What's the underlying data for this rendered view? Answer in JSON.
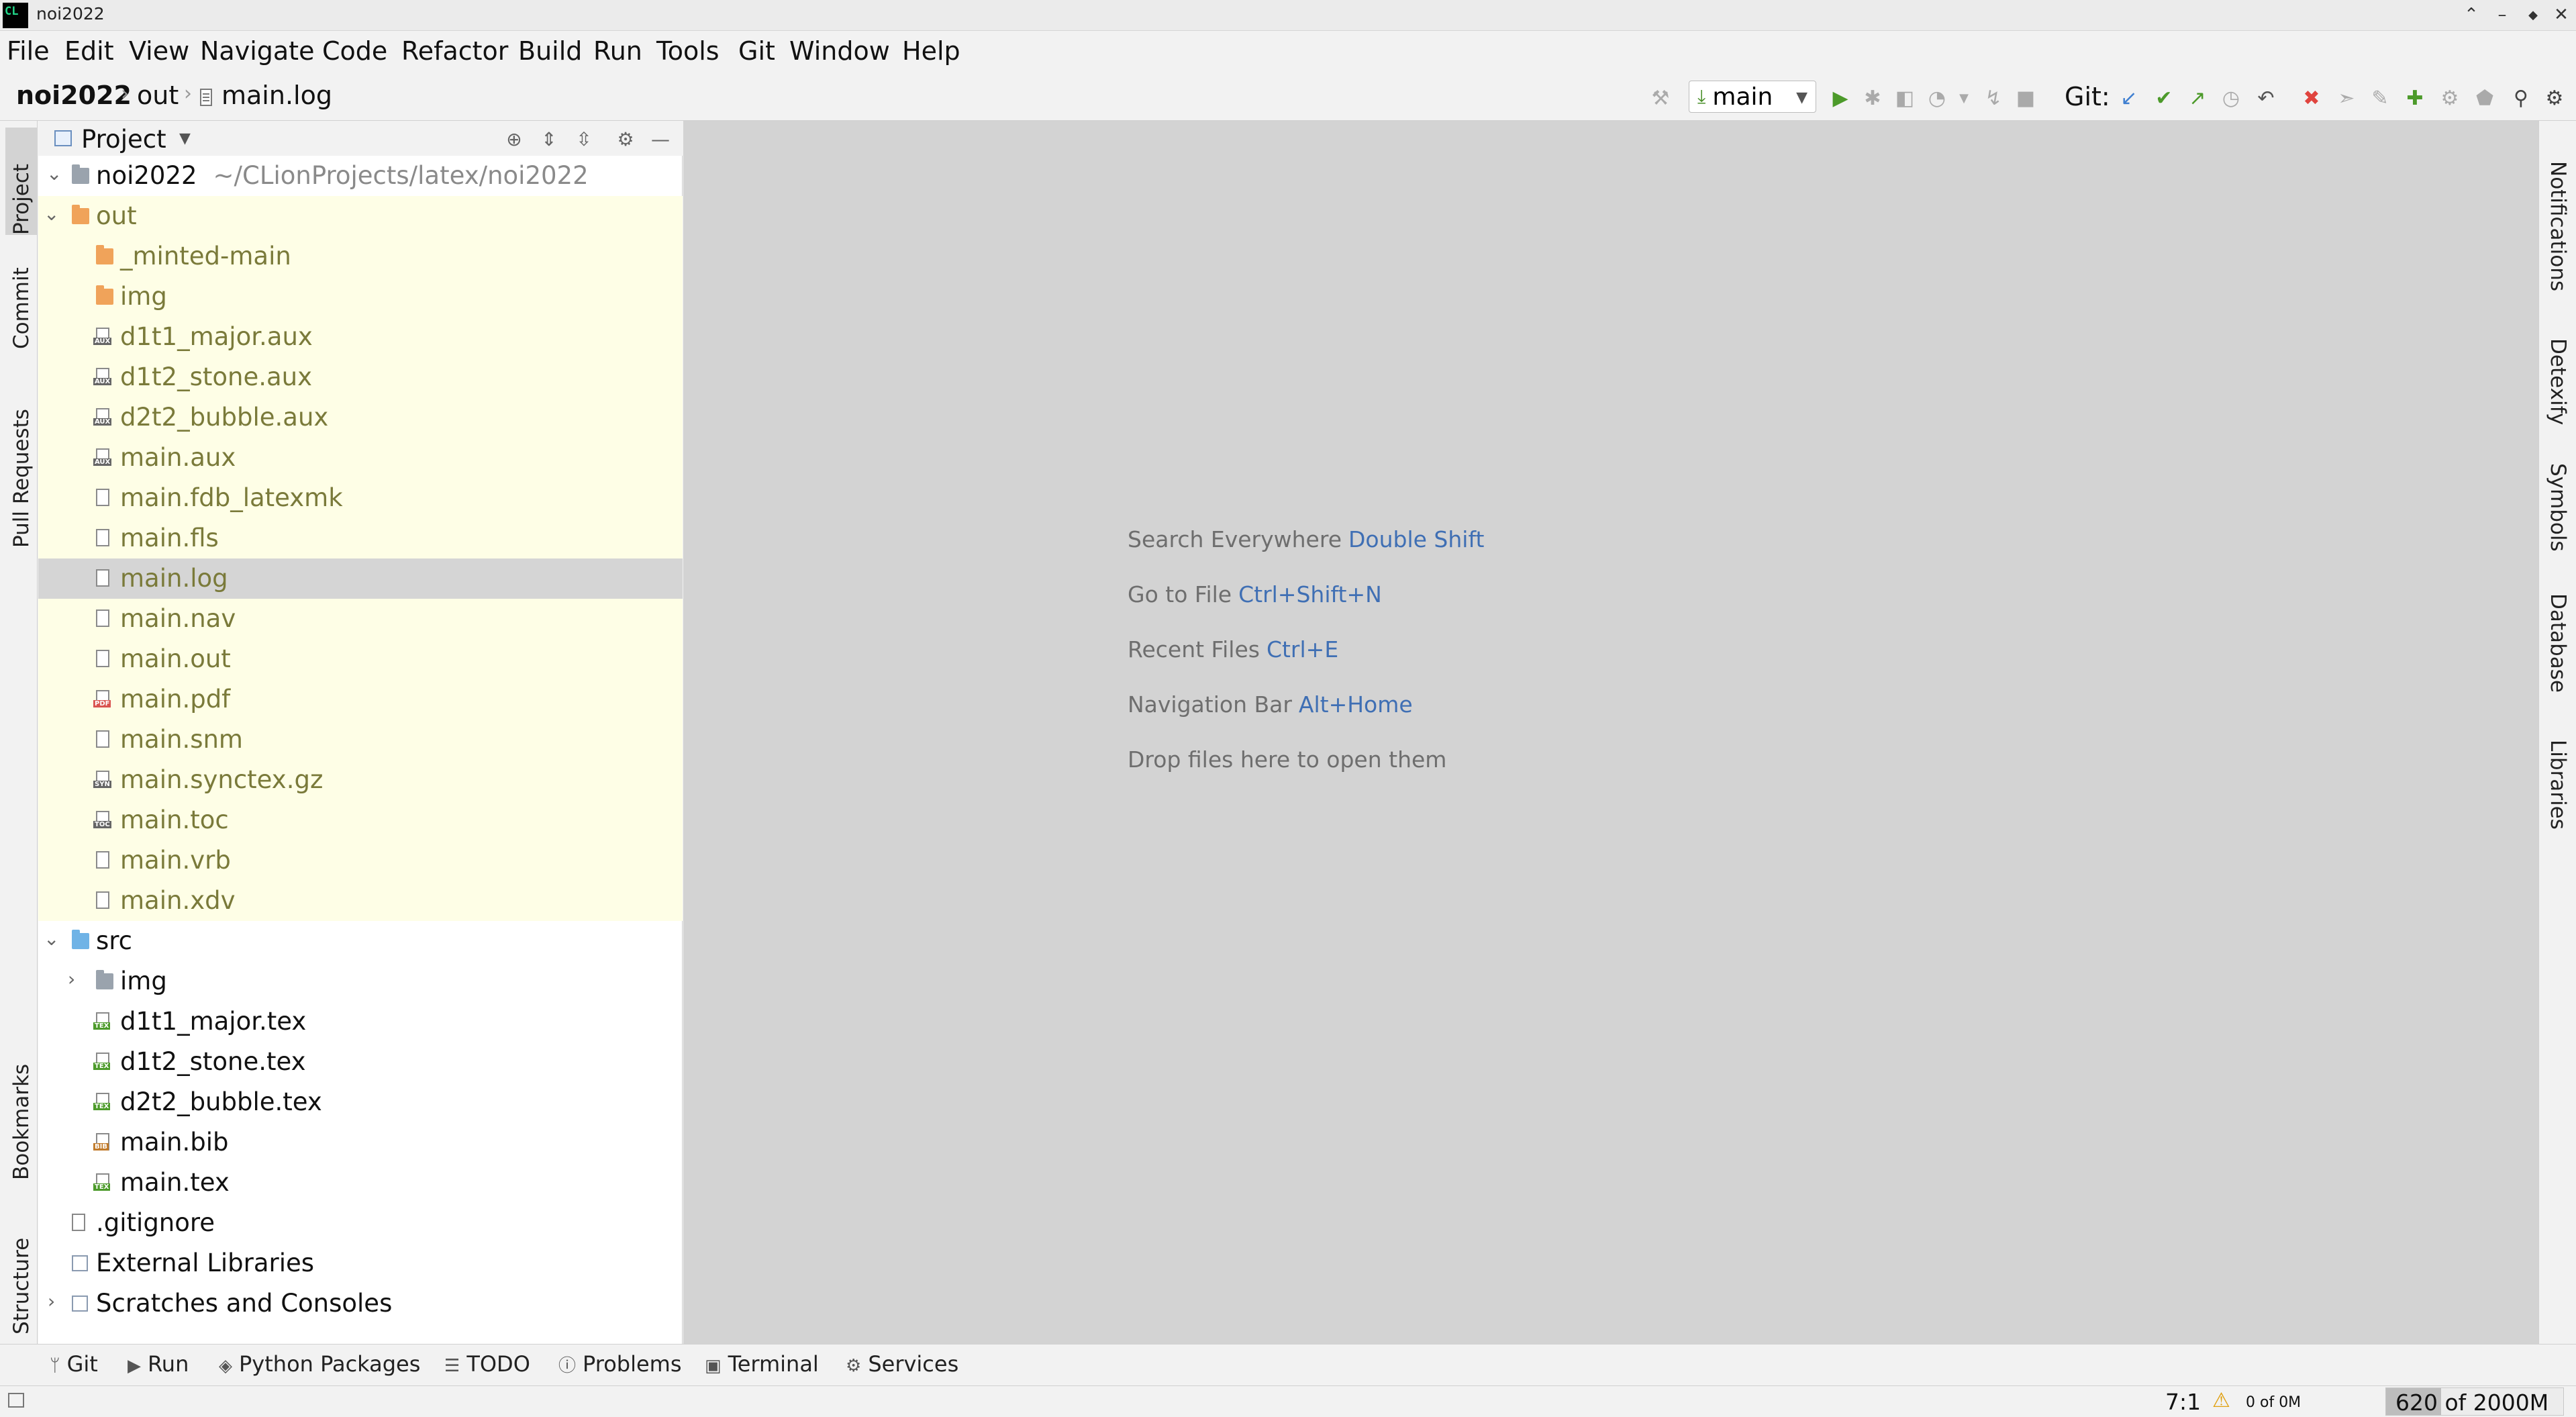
{
  "window": {
    "title": "noi2022",
    "app_icon_text": "CL"
  },
  "menu": [
    "File",
    "Edit",
    "View",
    "Navigate",
    "Code",
    "Refactor",
    "Build",
    "Run",
    "Tools",
    "Git",
    "Window",
    "Help"
  ],
  "breadcrumb": {
    "project": "noi2022",
    "folder": "out",
    "file": "main.log"
  },
  "toolbar": {
    "branch": "main",
    "git_label": "Git:"
  },
  "left_tabs": {
    "project": "Project",
    "commit": "Commit",
    "pull_requests": "Pull Requests",
    "bookmarks": "Bookmarks",
    "structure": "Structure"
  },
  "right_tabs": {
    "notifications": "Notifications",
    "detexify": "Detexify",
    "symbols": "Symbols",
    "database": "Database",
    "libraries": "Libraries"
  },
  "project_panel": {
    "title": "Project",
    "root_name": "noi2022",
    "root_path": "~/CLionProjects/latex/noi2022",
    "tree": [
      {
        "label": "out",
        "type": "folder-orange",
        "depth": 1,
        "expanded": true
      },
      {
        "label": "_minted-main",
        "type": "folder-orange",
        "depth": 2
      },
      {
        "label": "img",
        "type": "folder-orange",
        "depth": 2
      },
      {
        "label": "d1t1_major.aux",
        "type": "aux",
        "depth": 2
      },
      {
        "label": "d1t2_stone.aux",
        "type": "aux",
        "depth": 2
      },
      {
        "label": "d2t2_bubble.aux",
        "type": "aux",
        "depth": 2
      },
      {
        "label": "main.aux",
        "type": "aux",
        "depth": 2
      },
      {
        "label": "main.fdb_latexmk",
        "type": "file",
        "depth": 2
      },
      {
        "label": "main.fls",
        "type": "file",
        "depth": 2
      },
      {
        "label": "main.log",
        "type": "file",
        "depth": 2,
        "selected": true
      },
      {
        "label": "main.nav",
        "type": "file",
        "depth": 2
      },
      {
        "label": "main.out",
        "type": "file",
        "depth": 2
      },
      {
        "label": "main.pdf",
        "type": "pdf",
        "depth": 2
      },
      {
        "label": "main.snm",
        "type": "file",
        "depth": 2
      },
      {
        "label": "main.synctex.gz",
        "type": "syn",
        "depth": 2
      },
      {
        "label": "main.toc",
        "type": "toc",
        "depth": 2
      },
      {
        "label": "main.vrb",
        "type": "file",
        "depth": 2
      },
      {
        "label": "main.xdv",
        "type": "xdv",
        "depth": 2
      },
      {
        "label": "src",
        "type": "folder-blue",
        "depth": 1,
        "expanded": true
      },
      {
        "label": "img",
        "type": "folder-grey",
        "depth": 2,
        "collapsed": true
      },
      {
        "label": "d1t1_major.tex",
        "type": "tex",
        "depth": 2
      },
      {
        "label": "d1t2_stone.tex",
        "type": "tex",
        "depth": 2
      },
      {
        "label": "d2t2_bubble.tex",
        "type": "tex",
        "depth": 2
      },
      {
        "label": "main.bib",
        "type": "bib",
        "depth": 2
      },
      {
        "label": "main.tex",
        "type": "tex",
        "depth": 2
      },
      {
        "label": ".gitignore",
        "type": "git",
        "depth": 1
      }
    ],
    "external_libraries": "External Libraries",
    "scratches": "Scratches and Consoles"
  },
  "editor_hints": [
    {
      "text": "Search Everywhere",
      "key": "Double Shift"
    },
    {
      "text": "Go to File",
      "key": "Ctrl+Shift+N"
    },
    {
      "text": "Recent Files",
      "key": "Ctrl+E"
    },
    {
      "text": "Navigation Bar",
      "key": "Alt+Home"
    },
    {
      "text": "Drop files here to open them",
      "key": ""
    }
  ],
  "tool_windows": [
    "Git",
    "Run",
    "Python Packages",
    "TODO",
    "Problems",
    "Terminal",
    "Services"
  ],
  "status": {
    "position": "7:1",
    "progress": "0 of 0M",
    "memory": "620 of 2000M",
    "memory_used_fraction": 0.31
  },
  "colors": {
    "accent_blue": "#3f6fb4",
    "folder_orange": "#f0a35a",
    "folder_blue": "#6fb3e6",
    "highlight_row": "#fefee6"
  }
}
